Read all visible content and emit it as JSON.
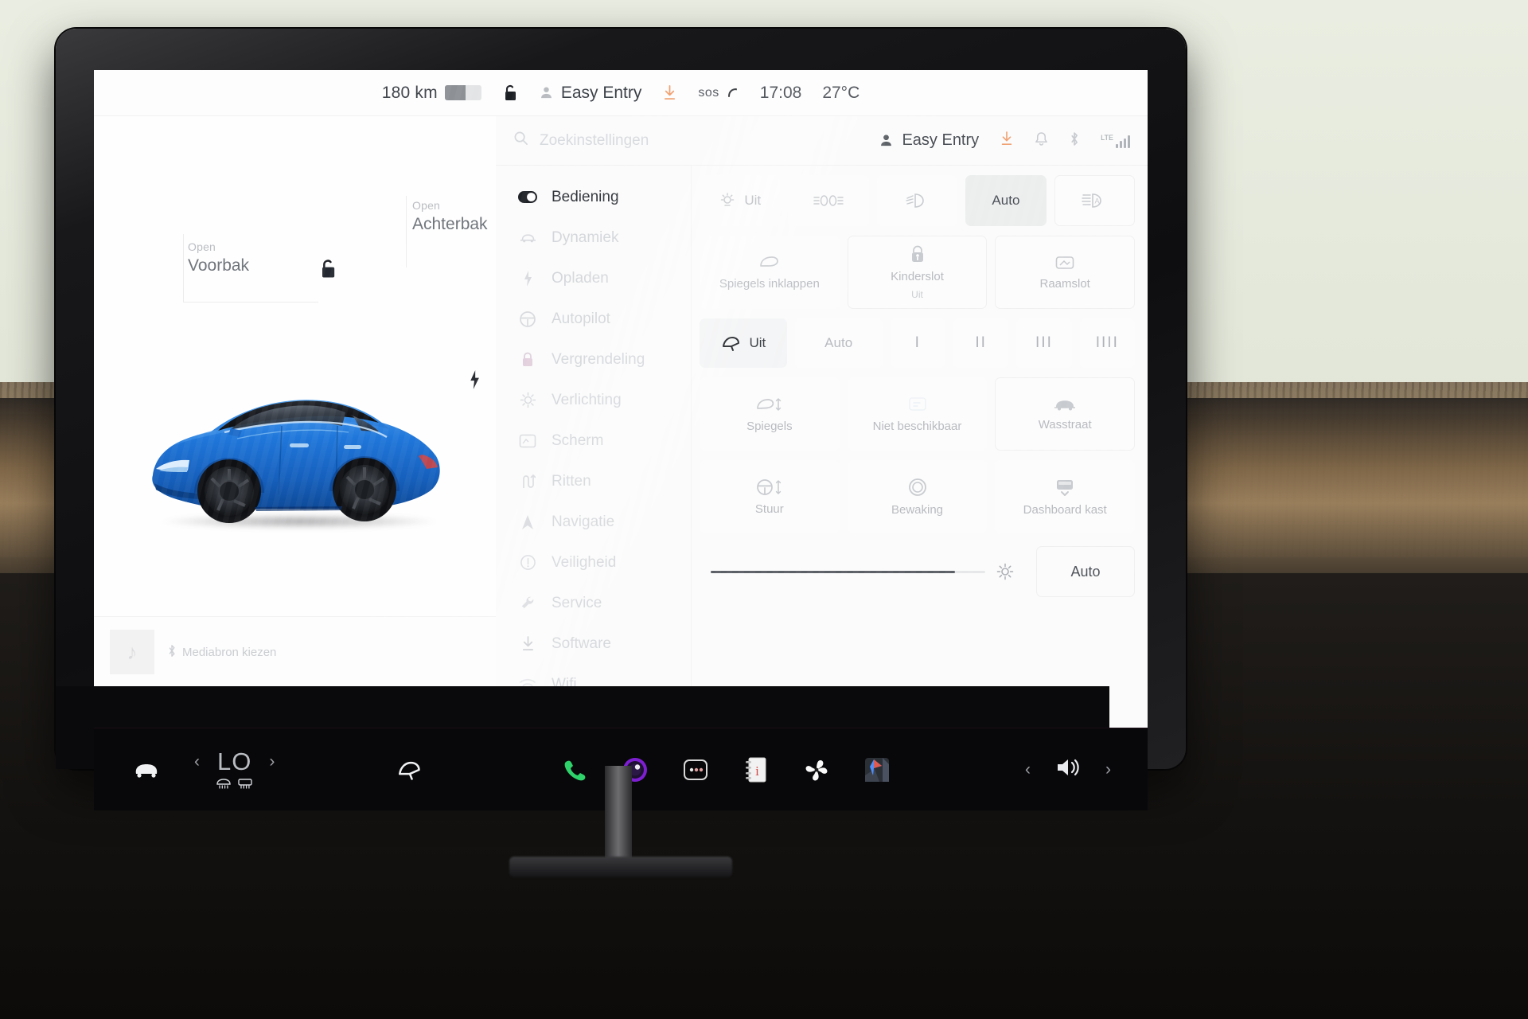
{
  "statusbar": {
    "range": "180 km",
    "battery_icon": "battery-icon",
    "lock_icon": "unlocked-padlock-icon",
    "profile_icon": "person-icon",
    "profile": "Easy Entry",
    "download_icon": "software-download-icon",
    "sos": "sos",
    "time": "17:08",
    "temperature": "27°C"
  },
  "car_view": {
    "front_trunk": {
      "action": "Open",
      "name": "Voorbak"
    },
    "rear_trunk": {
      "action": "Open",
      "name": "Achterbak"
    },
    "lock_icon": "unlocked-padlock-icon",
    "charge_port_icon": "charge-bolt-icon",
    "car_color": "#1f6fd0"
  },
  "media": {
    "source_label": "Mediabron kiezen",
    "bluetooth_icon": "bluetooth-icon",
    "album_icon": "music-note-icon",
    "controls": [
      {
        "name": "previous-track-button",
        "glyph": "⏮"
      },
      {
        "name": "play-button",
        "glyph": "▶"
      },
      {
        "name": "next-track-button",
        "glyph": "⏭"
      },
      {
        "name": "equalizer-button",
        "glyph": "⎇"
      },
      {
        "name": "search-media-button",
        "glyph": "⌕"
      }
    ]
  },
  "settings": {
    "search_placeholder": "Zoekinstellingen",
    "search_icon": "search-icon",
    "profile": "Easy Entry",
    "profile_icon": "person-icon",
    "header_icons": [
      "software-download-icon",
      "bell-icon",
      "bluetooth-icon"
    ],
    "connection": {
      "type": "LTE",
      "bars": 4
    },
    "nav_items": [
      {
        "label": "Bediening",
        "icon": "toggle-switch-icon",
        "active": true
      },
      {
        "label": "Dynamiek",
        "icon": "car-dynamics-icon",
        "active": false
      },
      {
        "label": "Opladen",
        "icon": "charge-bolt-icon",
        "active": false
      },
      {
        "label": "Autopilot",
        "icon": "steering-wheel-icon",
        "active": false
      },
      {
        "label": "Vergrendeling",
        "icon": "padlock-icon",
        "active": false
      },
      {
        "label": "Verlichting",
        "icon": "sun-brightness-icon",
        "active": false
      },
      {
        "label": "Scherm",
        "icon": "display-screen-icon",
        "active": false
      },
      {
        "label": "Ritten",
        "icon": "trips-route-icon",
        "active": false
      },
      {
        "label": "Navigatie",
        "icon": "navigation-arrow-icon",
        "active": false
      },
      {
        "label": "Veiligheid",
        "icon": "alert-circle-icon",
        "active": false
      },
      {
        "label": "Service",
        "icon": "wrench-icon",
        "active": false
      },
      {
        "label": "Software",
        "icon": "software-download-icon",
        "active": false
      },
      {
        "label": "Wifi",
        "icon": "wifi-icon",
        "active": false
      }
    ],
    "lights_row": [
      {
        "label": "Uit",
        "icon": "lamp-off-icon",
        "selected": false
      },
      {
        "label": "",
        "icon": "parking-lights-icon",
        "selected": false
      },
      {
        "label": "",
        "icon": "low-beam-icon",
        "selected": false
      },
      {
        "label": "Auto",
        "icon": "",
        "selected": true
      },
      {
        "label": "",
        "icon": "auto-high-beam-icon",
        "selected": false
      }
    ],
    "mirrors_row": [
      {
        "label": "Spiegels inklappen",
        "sub": "",
        "icon": "mirror-fold-icon"
      },
      {
        "label": "Kinderslot",
        "sub": "Uit",
        "icon": "child-lock-icon"
      },
      {
        "label": "Raamslot",
        "sub": "",
        "icon": "window-lock-icon"
      }
    ],
    "wiper_row": [
      {
        "label": "Uit",
        "icon": "wiper-icon",
        "selected": true
      },
      {
        "label": "Auto",
        "icon": "",
        "selected": false
      },
      {
        "label": "I",
        "icon": "",
        "selected": false
      },
      {
        "label": "II",
        "icon": "",
        "selected": false
      },
      {
        "label": "III",
        "icon": "",
        "selected": false
      },
      {
        "label": "IIII",
        "icon": "",
        "selected": false
      }
    ],
    "adjust_row": [
      {
        "label": "Spiegels",
        "icon": "mirror-adjust-icon",
        "disabled": false
      },
      {
        "label": "Niet beschikbaar",
        "icon": "unavailable-icon",
        "disabled": true
      },
      {
        "label": "Wasstraat",
        "icon": "car-wash-icon",
        "disabled": false
      }
    ],
    "misc_row": [
      {
        "label": "Stuur",
        "icon": "steering-adjust-icon"
      },
      {
        "label": "Bewaking",
        "icon": "sentry-camera-icon"
      },
      {
        "label": "Dashboard kast",
        "icon": "glovebox-icon"
      }
    ],
    "brightness": {
      "value_percent": 89,
      "icon": "sun-brightness-icon",
      "auto_label": "Auto"
    }
  },
  "taskbar": {
    "car_icon": "car-front-icon",
    "temperature": "LO",
    "prev_icon": "chevron-left-icon",
    "next_icon": "chevron-right-icon",
    "defrost_icons": [
      "front-defrost-icon",
      "rear-defrost-icon"
    ],
    "wiper_icon": "wiper-icon",
    "apps": [
      {
        "name": "phone-app-icon",
        "color": "#2fd36b"
      },
      {
        "name": "camera-app-icon",
        "color": "#8a2be2"
      },
      {
        "name": "more-apps-icon",
        "color": "#d8d8d8"
      },
      {
        "name": "manual-app-icon",
        "color": "#e9e9e9"
      },
      {
        "name": "climate-fan-app-icon",
        "color": "#ffffff"
      },
      {
        "name": "navigation-app-icon",
        "color": "#3b7ddd"
      }
    ],
    "volume_icon": "volume-speaker-icon",
    "volume_next_icon": "chevron-right-icon",
    "volume_prev_icon": "chevron-left-icon"
  }
}
